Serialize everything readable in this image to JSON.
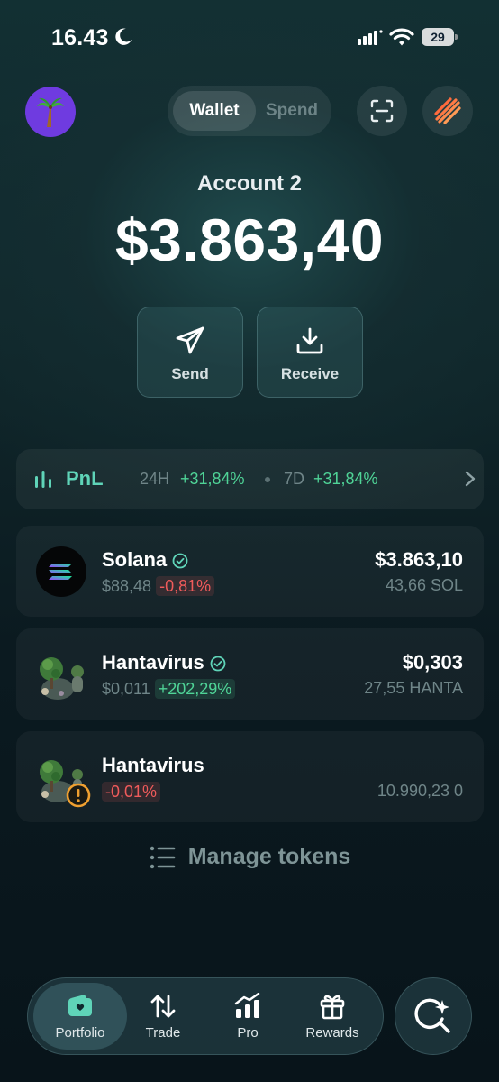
{
  "status_bar": {
    "time": "16.43",
    "battery": "29"
  },
  "header": {
    "segment": {
      "active": "Wallet",
      "inactive": "Spend"
    }
  },
  "account": {
    "name": "Account 2",
    "balance": "$3.863,40"
  },
  "actions": {
    "send": "Send",
    "receive": "Receive"
  },
  "pnl": {
    "title": "PnL",
    "period_24h_label": "24H",
    "period_24h_value": "+31,84%",
    "period_7d_label": "7D",
    "period_7d_value": "+31,84%"
  },
  "tokens": [
    {
      "name": "Solana",
      "price": "$88,48",
      "change": "-0,81%",
      "value": "$3.863,10",
      "amount": "43,66 SOL"
    },
    {
      "name": "Hantavirus",
      "price": "$0,011",
      "change": "+202,29%",
      "value": "$0,303",
      "amount": "27,55 HANTA"
    },
    {
      "name": "Hantavirus",
      "price": "",
      "change": "-0,01%",
      "value": "",
      "amount": "10.990,23 0"
    }
  ],
  "manage_tokens": "Manage tokens",
  "nav": {
    "items": [
      {
        "label": "Portfolio"
      },
      {
        "label": "Trade"
      },
      {
        "label": "Pro"
      },
      {
        "label": "Rewards"
      }
    ]
  },
  "colors": {
    "positive": "#4fd497",
    "negative": "#f05b5b",
    "accent": "#5fd4b8",
    "avatar": "#6f3be0"
  }
}
